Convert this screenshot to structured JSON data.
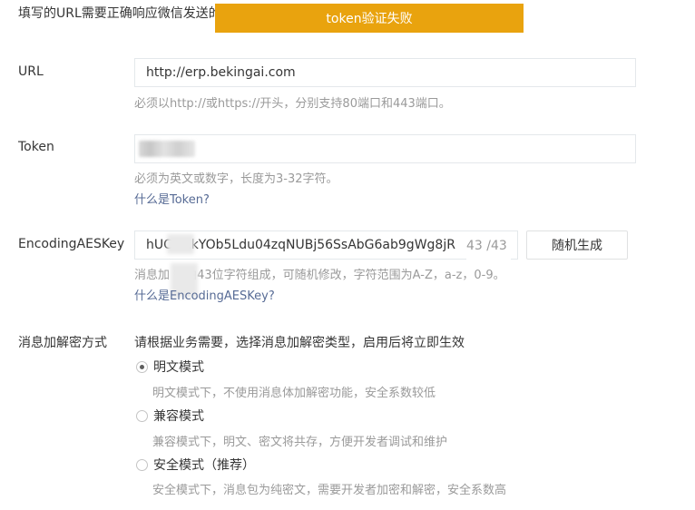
{
  "top_note": "填写的URL需要正确响应微信发送的",
  "toast": "token验证失败",
  "url": {
    "label": "URL",
    "value": "http://erp.bekingai.com",
    "hint": "必须以http://或https://开头，分别支持80端口和443端口。"
  },
  "token": {
    "label": "Token",
    "value": "",
    "hint": "必须为英文或数字，长度为3-32字符。",
    "link": "什么是Token?"
  },
  "aes": {
    "label": "EncodingAESKey",
    "value": "hUC  FAkYOb5Ldu04zqNUBj56SsAbG6ab9gWg8jR",
    "counter": "43 /43",
    "generate_button": "随机生成",
    "hint": "消息加    钥由43位字符组成，可随机修改，字符范围为A-Z，a-z，0-9。",
    "link": "什么是EncodingAESKey?"
  },
  "encryption": {
    "label": "消息加解密方式",
    "description": "请根据业务需要，选择消息加解密类型，启用后将立即生效",
    "options": [
      {
        "label": "明文模式",
        "hint": "明文模式下，不使用消息体加解密功能，安全系数较低",
        "checked": true
      },
      {
        "label": "兼容模式",
        "hint": "兼容模式下，明文、密文将共存，方便开发者调试和维护",
        "checked": false
      },
      {
        "label": "安全模式（推荐）",
        "hint": "安全模式下，消息包为纯密文，需要开发者加密和解密，安全系数高",
        "checked": false
      }
    ]
  },
  "colors": {
    "toast_bg": "#e9a30e",
    "link": "#576b95",
    "hint": "#9a9a9a"
  }
}
